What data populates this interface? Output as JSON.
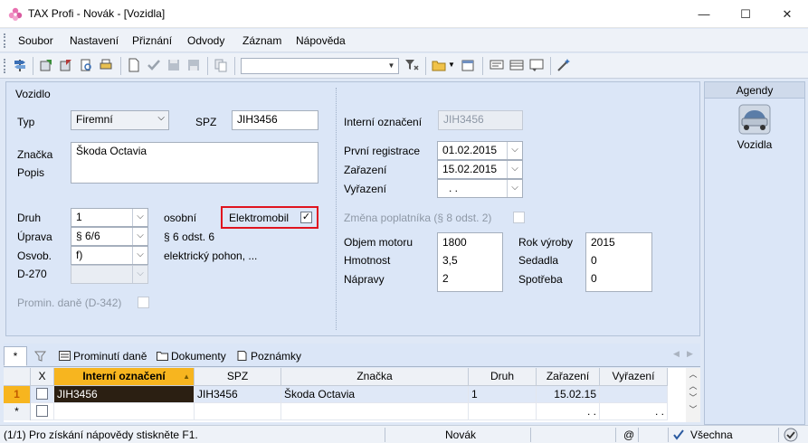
{
  "window": {
    "title": "TAX Profi - Novák - [Vozidla]",
    "minimize": "—",
    "maximize": "☐",
    "close": "✕"
  },
  "menu": [
    "Soubor",
    "Nastavení",
    "Přiznání",
    "Odvody",
    "Záznam",
    "Nápověda"
  ],
  "toolbar": {
    "filter_value": ""
  },
  "form": {
    "section_title": "Vozidlo",
    "typ_label": "Typ",
    "typ_value": "Firemní",
    "spz_label": "SPZ",
    "spz_value": "JIH3456",
    "interni_label": "Interní označení",
    "interni_value": "JIH3456",
    "znacka_label": "Značka",
    "popis_label": "Popis",
    "znacka_value": "Škoda Octavia",
    "prvni_registrace_label": "První registrace",
    "prvni_registrace_value": "01.02.2015",
    "zarazeni_label": "Zařazení",
    "zarazeni_value": "15.02.2015",
    "vyrazeni_label": "Vyřazení",
    "vyrazeni_value": ". .",
    "druh_label": "Druh",
    "druh_value": "1",
    "druh_desc": "osobní",
    "uprava_label": "Úprava",
    "uprava_value": "§ 6/6",
    "uprava_desc": "§ 6 odst. 6",
    "osvob_label": "Osvob.",
    "osvob_value": "f)",
    "osvob_desc": "elektrický pohon, ...",
    "d270_label": "D-270",
    "elektromobil_label": "Elektromobil",
    "elektromobil_checked": true,
    "zmena_label": "Změna poplatníka (§ 8 odst. 2)",
    "promin_label": "Promin. daně (D-342)",
    "objem_label": "Objem motoru",
    "objem_value": "1800",
    "hmotnost_label": "Hmotnost",
    "hmotnost_value": "3,5",
    "napravy_label": "Nápravy",
    "napravy_value": "2",
    "rok_label": "Rok výroby",
    "rok_value": "2015",
    "sedadla_label": "Sedadla",
    "sedadla_value": "0",
    "spotreba_label": "Spotřeba",
    "spotreba_value": "0",
    "check_mark": "✓"
  },
  "agenda": {
    "title": "Agendy",
    "item": "Vozidla"
  },
  "tabs": [
    "*",
    "Prominutí daně",
    "Dokumenty",
    "Poznámky"
  ],
  "grid": {
    "headers": [
      "X",
      "Interní označení",
      "SPZ",
      "Značka",
      "Druh",
      "Zařazení",
      "Vyřazení"
    ],
    "rows": [
      {
        "ind": "1",
        "interni": "JIH3456",
        "spz": "JIH3456",
        "znacka": "Škoda Octavia",
        "druh": "1",
        "zarazeni": "15.02.15",
        "vyrazeni": ""
      },
      {
        "ind": "*",
        "interni": "",
        "spz": "",
        "znacka": "",
        "druh": "",
        "zarazeni": ". .",
        "vyrazeni": ". ."
      }
    ]
  },
  "status": {
    "help": "(1/1)  Pro získání nápovědy stiskněte F1.",
    "user": "Novák",
    "at": "@",
    "filter": "Všechna"
  },
  "colors": {
    "accent": "#f7b51f",
    "highlight": "#e0141f",
    "panel": "#dbe6f7"
  }
}
